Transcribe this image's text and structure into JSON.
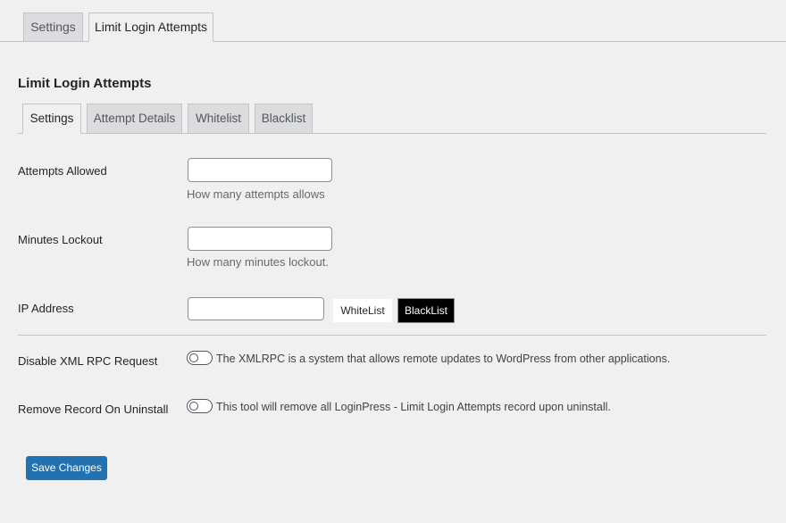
{
  "top_tabs": [
    {
      "label": "Settings",
      "active": false
    },
    {
      "label": "Limit Login Attempts",
      "active": true
    }
  ],
  "section_title": "Limit Login Attempts",
  "sub_tabs": [
    {
      "label": "Settings",
      "active": true
    },
    {
      "label": "Attempt Details",
      "active": false
    },
    {
      "label": "Whitelist",
      "active": false
    },
    {
      "label": "Blacklist",
      "active": false
    }
  ],
  "attempts_allowed": {
    "label": "Attempts Allowed",
    "value": "",
    "help": "How many attempts allows"
  },
  "minutes_lockout": {
    "label": "Minutes Lockout",
    "value": "",
    "help": "How many minutes lockout."
  },
  "ip_address": {
    "label": "IP Address",
    "value": "",
    "whitelist_button": "WhiteList",
    "blacklist_button": "BlackList"
  },
  "disable_xmlrpc": {
    "label": "Disable XML RPC Request",
    "description": "The XMLRPC is a system that allows remote updates to WordPress from other applications.",
    "enabled": false
  },
  "remove_record": {
    "label": "Remove Record On Uninstall",
    "description": "This tool will remove all LoginPress - Limit Login Attempts record upon uninstall.",
    "enabled": false
  },
  "save_button": "Save Changes",
  "colors": {
    "primary_button": "#2271b1",
    "background": "#f0f0f1"
  }
}
